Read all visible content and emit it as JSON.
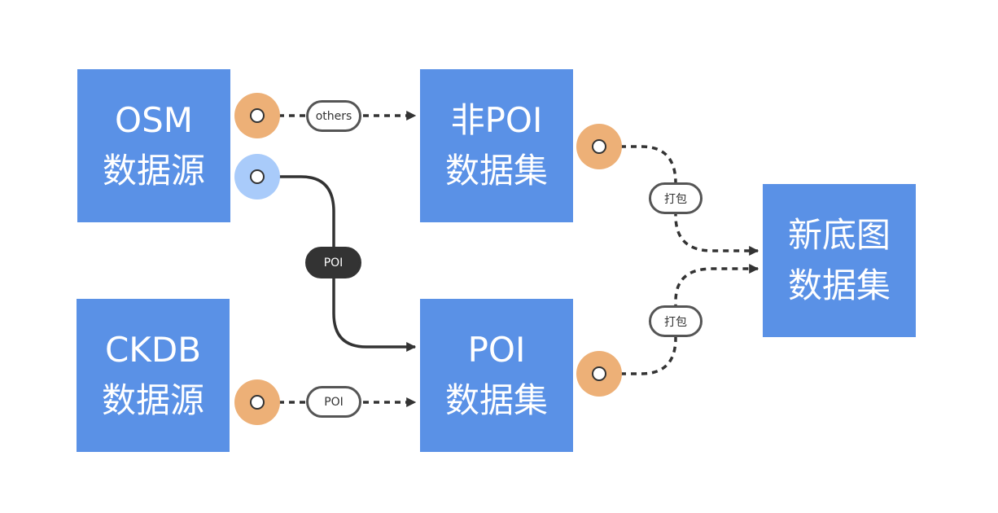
{
  "nodes": {
    "osm": {
      "line1": "OSM",
      "line2": "数据源"
    },
    "ckdb": {
      "line1": "CKDB",
      "line2": "数据源"
    },
    "non_poi": {
      "line1": "非POI",
      "line2": "数据集"
    },
    "poi": {
      "line1": "POI",
      "line2": "数据集"
    },
    "new_base": {
      "line1": "新底图",
      "line2": "数据集"
    }
  },
  "edge_labels": {
    "osm_to_non_poi": "others",
    "osm_to_poi": "POI",
    "ckdb_to_poi": "POI",
    "non_poi_to_new": "打包",
    "poi_to_new": "打包"
  },
  "colors": {
    "node_fill": "#5A91E6",
    "node_text": "#FFFFFF",
    "port_orange": "#EDB077",
    "port_blue": "#A9CBFA",
    "edge": "#333333",
    "pill_border": "#555555"
  }
}
